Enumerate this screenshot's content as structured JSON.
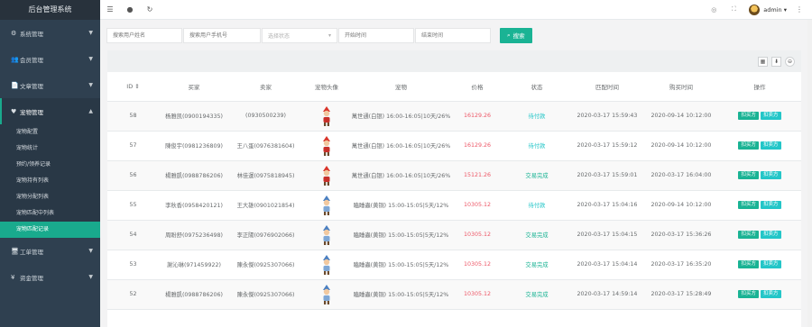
{
  "app_title": "后台管理系统",
  "sidebar": {
    "menus": [
      {
        "icon": "⚙",
        "icon_name": "gear-icon",
        "label": "系统管理",
        "open": false
      },
      {
        "icon": "👥",
        "icon_name": "users-icon",
        "label": "会员管理",
        "open": false
      },
      {
        "icon": "📄",
        "icon_name": "document-icon",
        "label": "文章管理",
        "open": false
      },
      {
        "icon": "♥",
        "icon_name": "heart-icon",
        "label": "宠物管理",
        "open": true
      },
      {
        "icon": "🖥",
        "icon_name": "monitor-icon",
        "label": "工单管理",
        "open": false
      },
      {
        "icon": "¥",
        "icon_name": "yen-icon",
        "label": "资金管理",
        "open": false
      }
    ],
    "pet_submenu": [
      "宠物配置",
      "宠物统计",
      "预约/领养记录",
      "宠物持有列表",
      "宠物分配列表",
      "宠物匹配中列表",
      "宠物匹配记录"
    ],
    "active_sub": 6
  },
  "topbar": {
    "admin_name": "admin ▾"
  },
  "search": {
    "buyer_placeholder": "搜索用户姓名",
    "seller_placeholder": "搜索用户手机号",
    "status_placeholder": "选择状态",
    "start_placeholder": "开始时间",
    "end_placeholder": "结束时间",
    "button_label": "搜索"
  },
  "table": {
    "headers": [
      "ID ⇕",
      "买家",
      "卖家",
      "宠物头像",
      "宠物",
      "价格",
      "状态",
      "匹配时间",
      "购买时间",
      "操作"
    ],
    "op_buyer": "扣买方",
    "op_seller": "扣卖方",
    "rows": [
      {
        "id": "58",
        "buyer": "杨雅凯(0900194335)",
        "seller": "(0930500239)",
        "pet": "萬世通(白银) 16:00-16:05|10天/26%",
        "price": "16129.26",
        "status": "待付款",
        "match_time": "2020-03-17 15:59:43",
        "buy_time": "2020-09-14 10:12:00",
        "avatar": "red",
        "status_type": "pending"
      },
      {
        "id": "57",
        "buyer": "陳俊宇(0981236809)",
        "seller": "王八蛋(0976381604)",
        "pet": "萬世通(白银) 16:00-16:05|10天/26%",
        "price": "16129.26",
        "status": "待付款",
        "match_time": "2020-03-17 15:59:12",
        "buy_time": "2020-09-14 10:12:00",
        "avatar": "red",
        "status_type": "pending"
      },
      {
        "id": "56",
        "buyer": "楊雅凱(0988786206)",
        "seller": "林佳運(0975818945)",
        "pet": "萬世通(白银) 16:00-16:05|10天/26%",
        "price": "15121.26",
        "status": "交易完成",
        "match_time": "2020-03-17 15:59:01",
        "buy_time": "2020-03-17 16:04:00",
        "avatar": "red",
        "status_type": "done"
      },
      {
        "id": "55",
        "buyer": "李秋香(0958420121)",
        "seller": "王大雄(0901021854)",
        "pet": "瞌睡蟲(黄铜) 15:00-15:05|5天/12%",
        "price": "10305.12",
        "status": "待付款",
        "match_time": "2020-03-17 15:04:16",
        "buy_time": "2020-09-14 10:12:00",
        "avatar": "blue",
        "status_type": "pending"
      },
      {
        "id": "54",
        "buyer": "周盼舒(0975236498)",
        "seller": "李正陽(0976902066)",
        "pet": "瞌睡蟲(黄铜) 15:00-15:05|5天/12%",
        "price": "10305.12",
        "status": "交易完成",
        "match_time": "2020-03-17 15:04:15",
        "buy_time": "2020-03-17 15:36:26",
        "avatar": "blue",
        "status_type": "done"
      },
      {
        "id": "53",
        "buyer": "謝沁琳(971459922)",
        "seller": "陳永傑(0925307066)",
        "pet": "瞌睡蟲(黄铜) 15:00-15:05|5天/12%",
        "price": "10305.12",
        "status": "交易完成",
        "match_time": "2020-03-17 15:04:14",
        "buy_time": "2020-03-17 16:35:20",
        "avatar": "blue",
        "status_type": "done"
      },
      {
        "id": "52",
        "buyer": "楊雅凱(0988786206)",
        "seller": "陳永傑(0925307066)",
        "pet": "瞌睡蟲(黄铜) 15:00-15:05|5天/12%",
        "price": "10305.12",
        "status": "交易完成",
        "match_time": "2020-03-17 14:59:14",
        "buy_time": "2020-03-17 15:28:49",
        "avatar": "blue",
        "status_type": "done"
      }
    ]
  }
}
